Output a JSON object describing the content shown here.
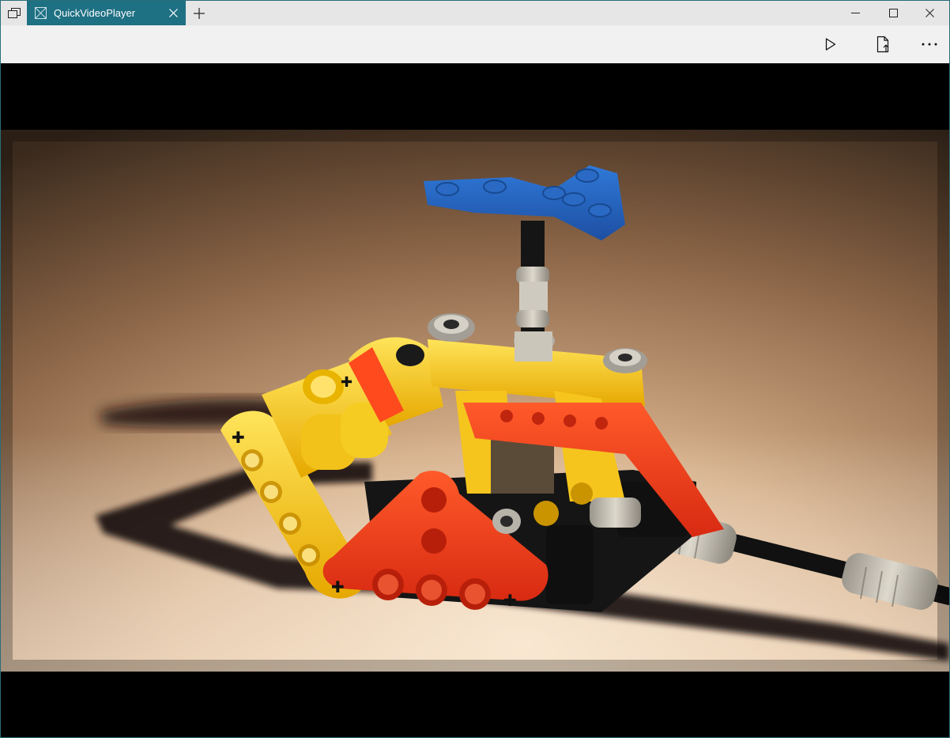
{
  "titlebar": {
    "tab_switcher_icon": "tab-switcher-icon",
    "tab": {
      "title": "QuickVideoPlayer",
      "icon": "app-icon",
      "close_icon": "close-icon",
      "active_color": "#1e7083"
    },
    "new_tab_icon": "plus-icon",
    "window_controls": [
      "minimize-icon",
      "maximize-icon",
      "close-icon"
    ]
  },
  "toolbar": {
    "buttons": [
      "play-icon",
      "open-file-icon",
      "more-icon"
    ]
  },
  "video": {
    "subject": "lego-technic-helicopter-rotor-model",
    "background_color": "#000000"
  }
}
